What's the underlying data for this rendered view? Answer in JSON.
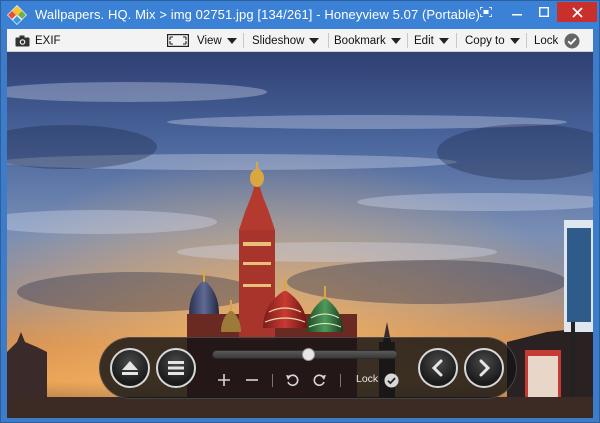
{
  "window": {
    "title": "Wallpapers. HQ. Mix > img 02751.jpg [134/261] - Honeyview 5.07 (Portable)"
  },
  "toolbar": {
    "exif": "EXIF",
    "view": "View",
    "slideshow": "Slideshow",
    "bookmark": "Bookmark",
    "edit": "Edit",
    "copy_to": "Copy to",
    "lock": "Lock"
  },
  "controls": {
    "lock_label": "Lock",
    "slider_position": 0.52
  },
  "colors": {
    "titlebar": "#3b82d6",
    "close_button": "#c9302c",
    "toolbar_bg": "#f3f3f3"
  },
  "icons": [
    "app-icon",
    "fullscreen-icon",
    "minimize-icon",
    "maximize-icon",
    "close-icon",
    "camera-icon",
    "view-frame-icon",
    "check-circle-icon",
    "eject-icon",
    "menu-icon",
    "zoom-in-icon",
    "zoom-out-icon",
    "rotate-left-icon",
    "rotate-right-icon",
    "previous-icon",
    "next-icon"
  ]
}
